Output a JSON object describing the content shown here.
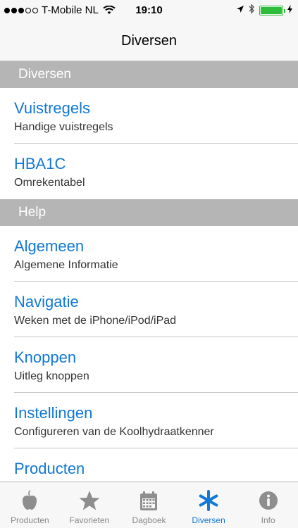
{
  "status_bar": {
    "carrier": "T-Mobile NL",
    "time": "19:10",
    "signal_bars": 3,
    "battery_level": 1.0
  },
  "nav": {
    "title": "Diversen"
  },
  "sections": [
    {
      "header": "Diversen",
      "rows": [
        {
          "title": "Vuistregels",
          "subtitle": "Handige vuistregels"
        },
        {
          "title": "HBA1C",
          "subtitle": "Omrekentabel"
        }
      ]
    },
    {
      "header": "Help",
      "rows": [
        {
          "title": "Algemeen",
          "subtitle": "Algemene Informatie"
        },
        {
          "title": "Navigatie",
          "subtitle": "Weken met de iPhone/iPod/iPad"
        },
        {
          "title": "Knoppen",
          "subtitle": "Uitleg knoppen"
        },
        {
          "title": "Instellingen",
          "subtitle": "Configureren van de Koolhydraatkenner"
        },
        {
          "title": "Producten",
          "subtitle": ""
        }
      ]
    }
  ],
  "tabs": [
    {
      "label": "Producten",
      "icon": "apple-icon"
    },
    {
      "label": "Favorieten",
      "icon": "star-icon"
    },
    {
      "label": "Dagboek",
      "icon": "calendar-icon"
    },
    {
      "label": "Diversen",
      "icon": "asterisk-icon",
      "active": true
    },
    {
      "label": "Info",
      "icon": "info-icon"
    }
  ],
  "colors": {
    "accent": "#1178d6",
    "section_header": "#b5b5b5",
    "battery": "#2ebd3a",
    "inactive_tab": "#8e8e8e"
  }
}
